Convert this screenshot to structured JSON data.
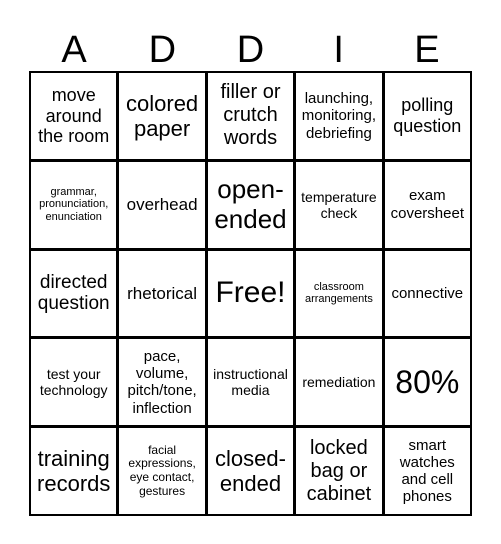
{
  "header": {
    "letters": [
      "A",
      "D",
      "D",
      "I",
      "E"
    ]
  },
  "cells": [
    [
      "move around the room",
      "colored paper",
      "filler or crutch words",
      "launching, monitoring, debriefing",
      "polling question"
    ],
    [
      "grammar, pronunciation, enunciation",
      "overhead",
      "open-ended",
      "temperature check",
      "exam coversheet"
    ],
    [
      "directed question",
      "rhetorical",
      "Free!",
      "classroom arrangements",
      "connective"
    ],
    [
      "test your technology",
      "pace, volume, pitch/tone, inflection",
      "instructional media",
      "remediation",
      "80%"
    ],
    [
      "training records",
      "facial expressions, eye contact, gestures",
      "closed-ended",
      "locked bag or cabinet",
      "smart watches and cell phones"
    ]
  ]
}
